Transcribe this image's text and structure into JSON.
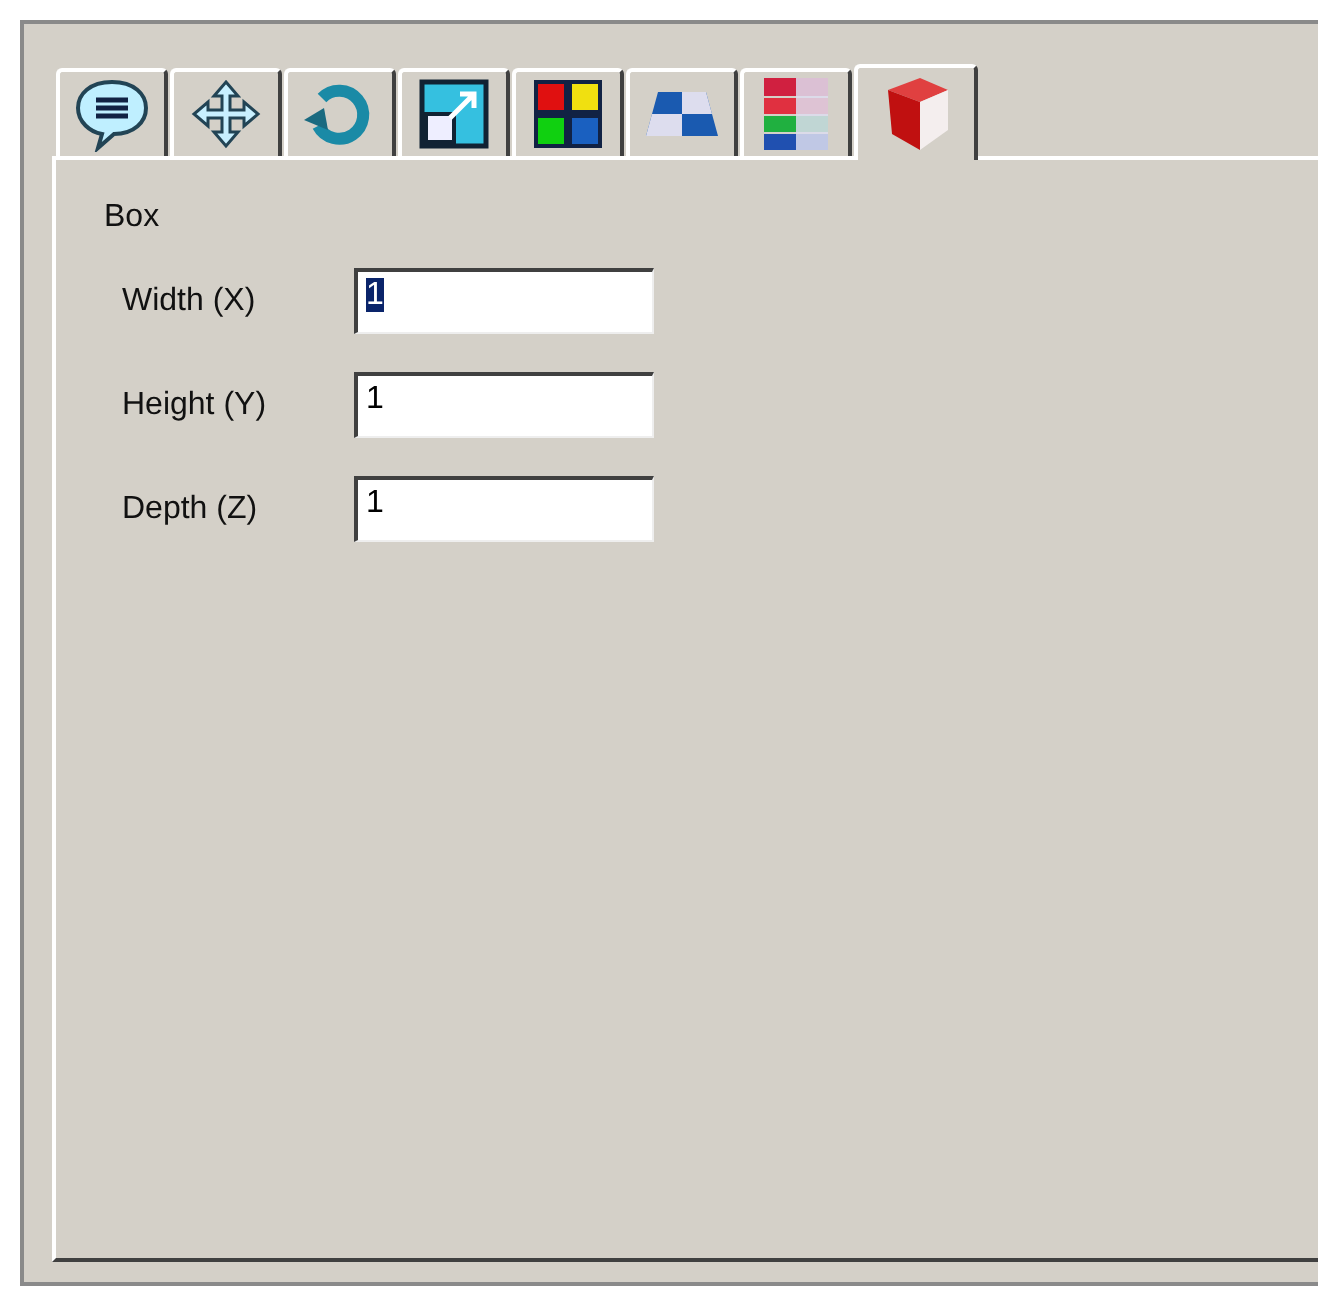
{
  "tabs": [
    {
      "kind": "speech",
      "selected": false
    },
    {
      "kind": "move",
      "selected": false
    },
    {
      "kind": "rotate",
      "selected": false
    },
    {
      "kind": "scale",
      "selected": false
    },
    {
      "kind": "colors",
      "selected": false
    },
    {
      "kind": "plane",
      "selected": false
    },
    {
      "kind": "layers",
      "selected": false
    },
    {
      "kind": "cube",
      "selected": true
    }
  ],
  "panel": {
    "title": "Box",
    "fields": [
      {
        "label": "Width (X)",
        "value": "1",
        "highlighted": true
      },
      {
        "label": "Height (Y)",
        "value": "1",
        "highlighted": false
      },
      {
        "label": "Depth (Z)",
        "value": "1",
        "highlighted": false
      }
    ]
  }
}
